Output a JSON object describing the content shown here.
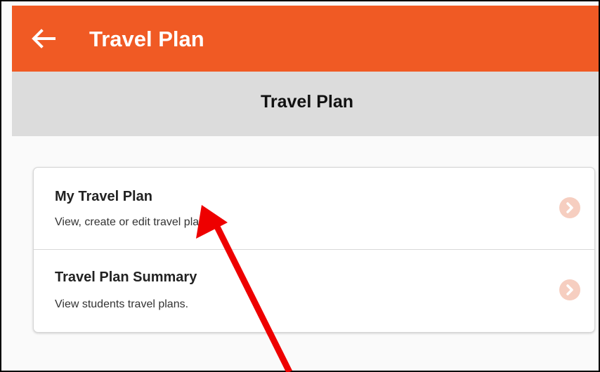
{
  "app_bar": {
    "title": "Travel Plan",
    "back_icon": "arrow-left-icon",
    "color": "#f05a24"
  },
  "section": {
    "title": "Travel Plan"
  },
  "menu": {
    "items": [
      {
        "title": "My Travel Plan",
        "subtitle": "View, create or edit travel plans.",
        "icon": "chevron-right-icon"
      },
      {
        "title": "Travel Plan Summary",
        "subtitle": "View students travel plans.",
        "icon": "chevron-right-icon"
      }
    ]
  },
  "annotation": {
    "icon": "red-pointer-arrow",
    "color": "#ee0000"
  }
}
